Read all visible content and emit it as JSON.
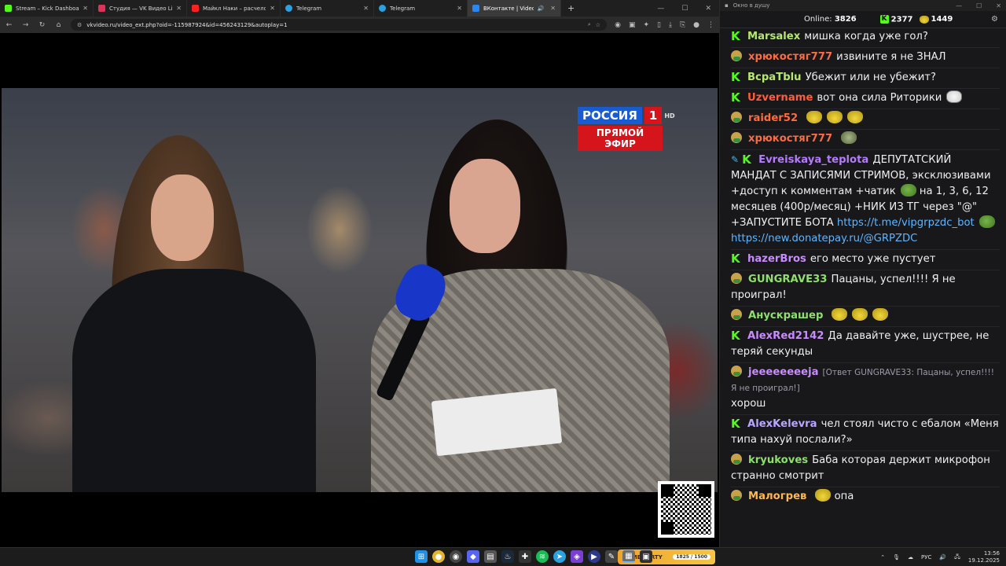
{
  "browser": {
    "tabs": [
      {
        "title": "Stream – Kick Dashboard",
        "color": "#53fc18",
        "active": false
      },
      {
        "title": "Студия — VK Видео Live",
        "color": "#e0315b",
        "active": false
      },
      {
        "title": "Майкл Наки – расчеловечени",
        "color": "#ff2020",
        "active": false
      },
      {
        "title": "Telegram",
        "color": "#2aa1e0",
        "active": false
      },
      {
        "title": "Telegram",
        "color": "#2aa1e0",
        "active": false
      },
      {
        "title": "ВКонтакте | Video Ext",
        "color": "#2787f5",
        "active": true
      }
    ],
    "url": "vkvideo.ru/video_ext.php?oid=-115987924&id=456243129&autoplay=1"
  },
  "video": {
    "channel_logo": "РОССИЯ",
    "channel_number": "1",
    "channel_hd": "HD",
    "live_label": "ПРЯМОЙ ЭФИР"
  },
  "chat": {
    "window_title": "Окно в душу",
    "online_label": "Online:",
    "online_count": "3826",
    "kick_count": "2377",
    "vk_count": "1449",
    "messages": [
      {
        "badge": "kick",
        "user": "Marsalex",
        "color": "#b6e86b",
        "text": "мишка когда уже гол?"
      },
      {
        "badge": "vk",
        "user": "хрюкостяг777",
        "color": "#ff6b3d",
        "text": "извините я не ЗНАЛ"
      },
      {
        "badge": "kick",
        "user": "BcpaTblu",
        "color": "#b6e86b",
        "text": "Убежит или не убежит?"
      },
      {
        "badge": "kick",
        "user": "Uzvername",
        "color": "#ff5c3a",
        "text": "вот она сила Риторики"
      },
      {
        "badge": "vk",
        "user": "raider52",
        "color": "#ff6b3d",
        "text": ""
      },
      {
        "badge": "vk",
        "user": "хрюкостяг777",
        "color": "#ff6b3d",
        "text": ""
      },
      {
        "badge": "kick",
        "user": "Evreiskaya_teplota",
        "color": "#b57bff",
        "text": "ДЕПУТАТСКИЙ МАНДАТ С ЗАПИСЯМИ СТРИМОВ, эксклюзивами +доступ к комментам +чатик",
        "text2": "на 1, 3, 6, 12 месяцев (400р/месяц) +НИК ИЗ ТГ через \"@\" +ЗАПУСТИТЕ БОТА",
        "link1": "https://t.me/vipgrpzdc_bot",
        "link2": "https://new.donatepay.ru/@GRPZDC"
      },
      {
        "badge": "kick",
        "user": "hazerBros",
        "color": "#c98bff",
        "text": "его место уже пустует"
      },
      {
        "badge": "vk",
        "user": "GUNGRAVE33",
        "color": "#8ee06a",
        "text": "Пацаны, успел!!!! Я не проиграл!"
      },
      {
        "badge": "vk",
        "user": "Анускрашер",
        "color": "#8ee06a",
        "text": ""
      },
      {
        "badge": "kick",
        "user": "AlexRed2142",
        "color": "#c98bff",
        "text": "Да давайте уже, шустрее, не теряй секунды"
      },
      {
        "badge": "vk",
        "user": "jeeeeeeeeja",
        "color": "#c98bff",
        "reply": "[Ответ GUNGRAVE33: Пацаны, успел!!!! Я не проиграл!]",
        "text": "хорош"
      },
      {
        "badge": "kick",
        "user": "AlexKelevra",
        "color": "#b9a6ff",
        "text": "чел стоял чисто с ебалом «Меня типа нахуй послали?»"
      },
      {
        "badge": "vk",
        "user": "kryukoves",
        "color": "#8ee06a",
        "text": "Баба которая держит микрофон странно смотрит"
      },
      {
        "badge": "vk",
        "user": "Малогрев",
        "color": "#ffb84d",
        "text": "опа"
      }
    ]
  },
  "taskbar": {
    "meme_label": "MEME PARTY",
    "meme_count": "1825 / 1500",
    "lang": "РУС",
    "time": "13:56",
    "date": "19.12.2025"
  }
}
